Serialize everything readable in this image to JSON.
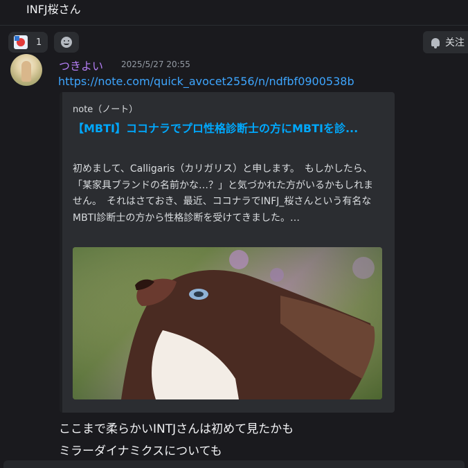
{
  "previous_message": {
    "text": "INFJ桜さん"
  },
  "reactions": [
    {
      "count": "1"
    }
  ],
  "follow_button": {
    "label": "关注"
  },
  "message": {
    "username": "つきよい",
    "timestamp": "2025/5/27 20:55",
    "link": "https://note.com/quick_avocet2556/n/ndfbf0900538b",
    "embed": {
      "provider": "note（ノート）",
      "title": "【MBTI】ココナラでプロ性格診断士の方にMBTIを診...",
      "description": "初めまして、Calligaris（カリガリス）と申します。　もしかしたら、「某家具ブランドの名前かな…？」と気づかれた方がいるかもしれません。　それはさておき、最近、ココナラでINFJ_桜さんという有名なMBTI診断士の方から性格診断を受けてきました。…"
    },
    "lines": [
      "ここまで柔らかいINTJさんは初めて見たかも",
      "ミラーダイナミクスについても"
    ]
  },
  "colors": {
    "username": "#b27df2",
    "link": "#3ea6ff",
    "embed_title": "#00a8fc",
    "background": "#1a1a1e"
  }
}
